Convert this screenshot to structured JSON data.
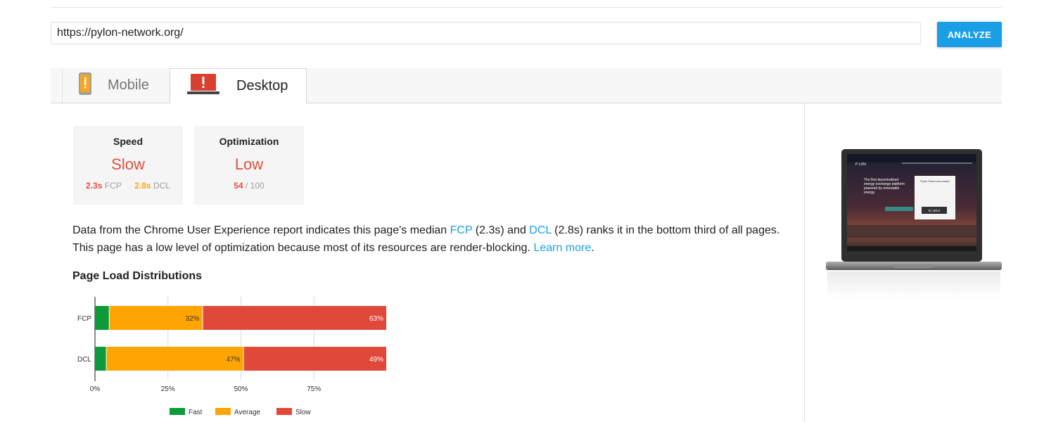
{
  "search": {
    "url_value": "https://pylon-network.org/",
    "analyze_label": "ANALYZE"
  },
  "tabs": [
    {
      "label": "Mobile",
      "icon": "mobile-phone-warning-icon",
      "selected": false
    },
    {
      "label": "Desktop",
      "icon": "laptop-warning-icon",
      "selected": true
    }
  ],
  "cards": {
    "speed": {
      "title": "Speed",
      "value": "Slow",
      "fcp_value": "2.3s",
      "fcp_label": "FCP",
      "dcl_value": "2.8s",
      "dcl_label": "DCL"
    },
    "optimization": {
      "title": "Optimization",
      "value": "Low",
      "score": "54",
      "score_max": "/ 100"
    }
  },
  "summary": {
    "part1": "Data from the Chrome User Experience report indicates this page's median ",
    "fcp_link": "FCP",
    "part2": " (2.3s) and ",
    "dcl_link": "DCL",
    "part3": " (2.8s) ranks it in the bottom third of all pages. This page has a low level of optimization because most of its resources are render-blocking. ",
    "learn_more": "Learn more",
    "part4": "."
  },
  "section_title": "Page Load Distributions",
  "colors": {
    "fast": "#0c9a3a",
    "average": "#ffa400",
    "slow": "#e0483a",
    "accent": "#1a9ee6"
  },
  "chart_data": {
    "type": "bar",
    "orientation": "horizontal-stacked",
    "categories": [
      "FCP",
      "DCL"
    ],
    "series": [
      {
        "name": "Fast",
        "values": [
          5,
          4
        ]
      },
      {
        "name": "Average",
        "values": [
          32,
          47
        ]
      },
      {
        "name": "Slow",
        "values": [
          63,
          49
        ]
      }
    ],
    "data_labels": [
      [
        "",
        "32%",
        "63%"
      ],
      [
        "",
        "47%",
        "49%"
      ]
    ],
    "x_ticks": [
      "0%",
      "25%",
      "50%",
      "75%"
    ],
    "xlim": [
      0,
      100
    ],
    "grid": true,
    "legend_position": "bottom"
  },
  "screenshot_preview": {
    "logo": "P LON",
    "headline": "The first decentralized energy exchange platform powered by renewable energy",
    "popup_title": "Pylon Token has ended",
    "popup_button": "B | Bit-Z"
  }
}
